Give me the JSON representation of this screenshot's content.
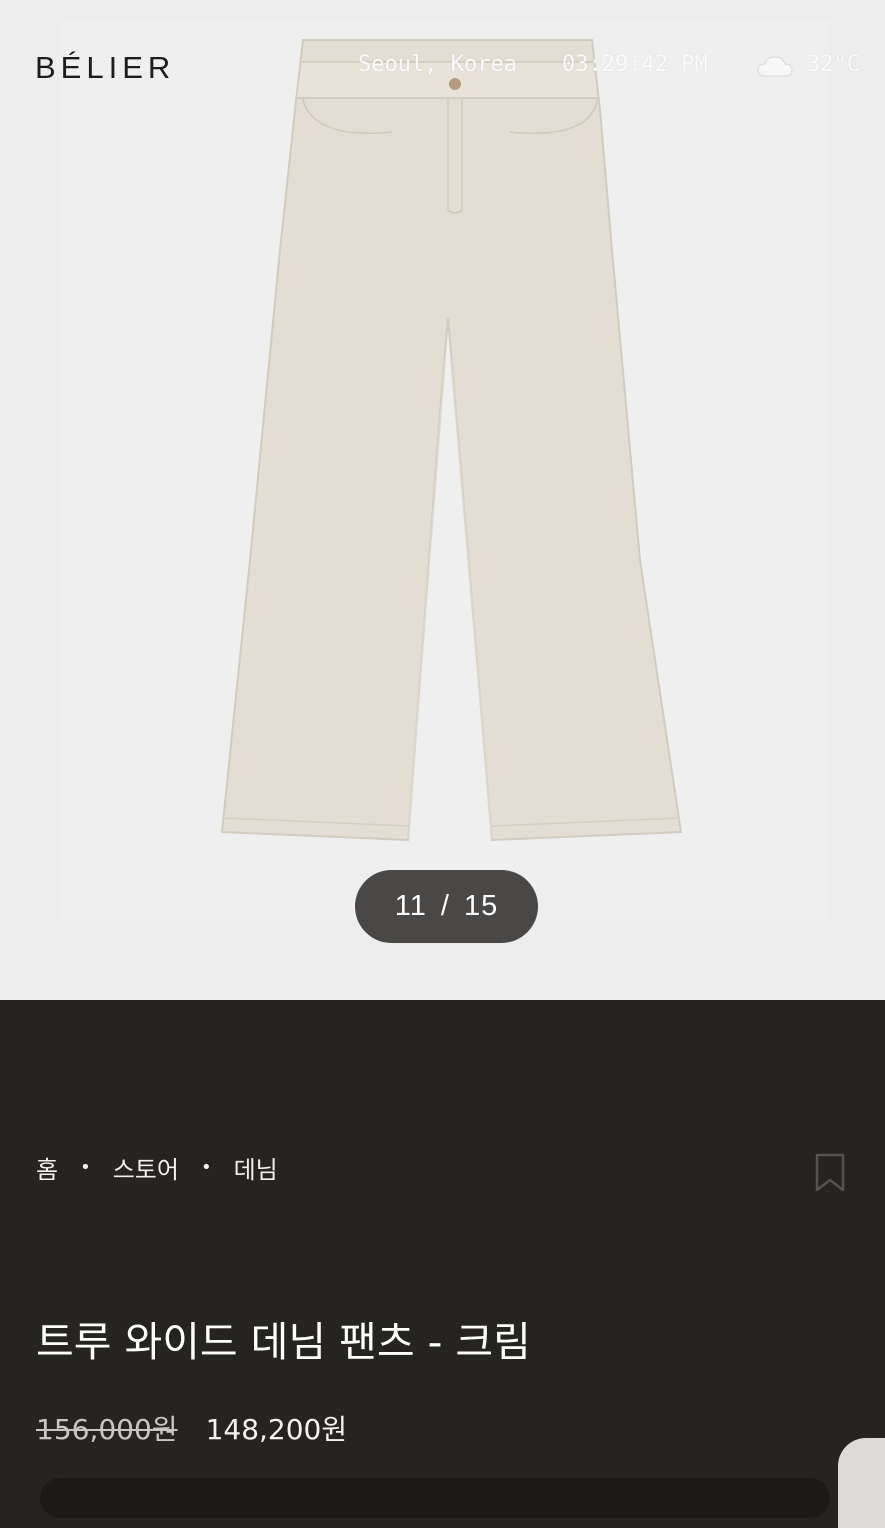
{
  "brand": {
    "logo": "BÉLIER"
  },
  "overlay": {
    "location": "Seoul, Korea",
    "time": "03:29:42 PM",
    "weather_icon": "cloud-icon",
    "temperature": "32°C"
  },
  "gallery": {
    "current": "11",
    "separator": "/",
    "total": "15"
  },
  "breadcrumb": {
    "items": [
      "홈",
      "스토어",
      "데님"
    ],
    "separator": "•"
  },
  "product": {
    "title": "트루 와이드 데님 팬츠 - 크림",
    "original_price": "156,000원",
    "sale_price": "148,200원"
  },
  "colors": {
    "hero_background": "#eeedee",
    "panel_background": "#262420",
    "pants_fabric": "#e3ddd4",
    "counter_pill": "#4a4846"
  }
}
